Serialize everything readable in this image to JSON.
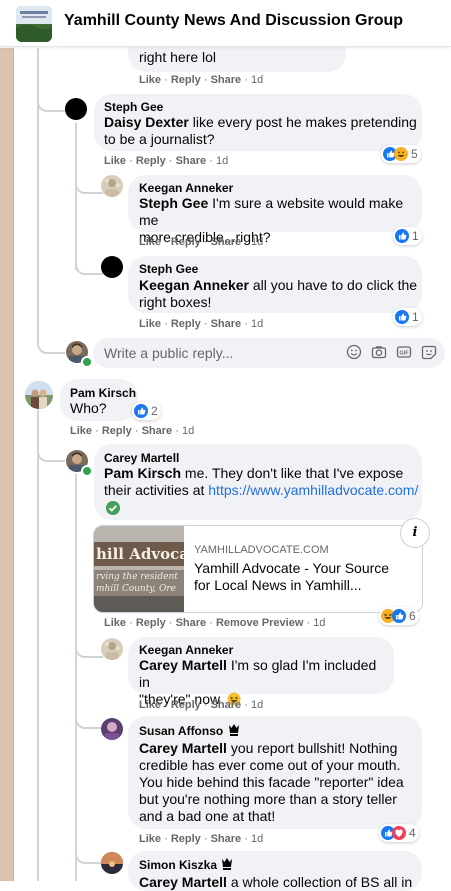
{
  "header": {
    "group_title": "Yamhill County News And Discussion Group"
  },
  "actions": {
    "like": "Like",
    "reply": "Reply",
    "share": "Share",
    "remove_preview": "Remove Preview",
    "dot": "·"
  },
  "comments": [
    {
      "id": "c0",
      "text": "right here lol",
      "time": "1d"
    },
    {
      "id": "c1",
      "author": "Steph Gee",
      "mention": "Daisy Dexter",
      "text_line1": " like every post he makes pretending",
      "text_line2": "to be a journalist?",
      "time": "1d",
      "reaction_count": "5"
    },
    {
      "id": "c2",
      "author": "Keegan Anneker",
      "mention": "Steph Gee",
      "text_line1": " I'm sure a website would make me",
      "text_line2": "more credible...right?",
      "time": "1d",
      "reaction_count": "1"
    },
    {
      "id": "c3",
      "author": "Steph Gee",
      "mention": "Keegan Anneker",
      "text_line1": " all you have to do click the",
      "text_line2": "right boxes!",
      "time": "1d",
      "reaction_count": "1"
    },
    {
      "id": "c4",
      "author": "Pam Kirsch",
      "text": "Who?",
      "time": "1d",
      "reaction_count": "2"
    },
    {
      "id": "c5",
      "author": "Carey Martell",
      "mention": "Pam Kirsch",
      "text_line1": " me. They don't like that I've expose",
      "text_line2": "their activities at ",
      "link": "https://www.yamhilladvocate.com/",
      "time": "1d",
      "reaction_count": "6"
    },
    {
      "id": "c6",
      "author": "Keegan Anneker",
      "mention": "Carey Martell",
      "text_line1": " I'm so glad I'm included in",
      "text_line2": "\"they're\" now",
      "time": "1d"
    },
    {
      "id": "c7",
      "author": "Susan Affonso",
      "mention": "Carey Martell",
      "text_line1": " you report bullshit! Nothing",
      "text_line2": "credible has ever come out of your mouth.",
      "text_line3": "You hide behind this facade \"reporter\" idea",
      "text_line4": "but you're nothing more than a story teller",
      "text_line5": "and a bad one at that!",
      "time": "1d",
      "reaction_count": "4"
    },
    {
      "id": "c8",
      "author": "Simon Kiszka",
      "mention": "Carey Martell",
      "text_line1": " a whole collection of BS all in"
    }
  ],
  "reply_box": {
    "placeholder": "Write a public reply..."
  },
  "link_preview": {
    "domain": "YAMHILLADVOCATE.COM",
    "title_line1": "Yamhill Advocate - Your Source",
    "title_line2": "for Local News in Yamhill...",
    "image_text_line1": "hill Advoca",
    "image_text_line2": "rving the resident",
    "image_text_line3": "mhill County, Ore",
    "info_label": "i"
  },
  "colors": {
    "like_blue": "#1877f2",
    "link_blue": "#216fdb",
    "bubble_gray": "#f0f2f5",
    "meta_gray": "#65676b",
    "online_green": "#31a24c"
  }
}
